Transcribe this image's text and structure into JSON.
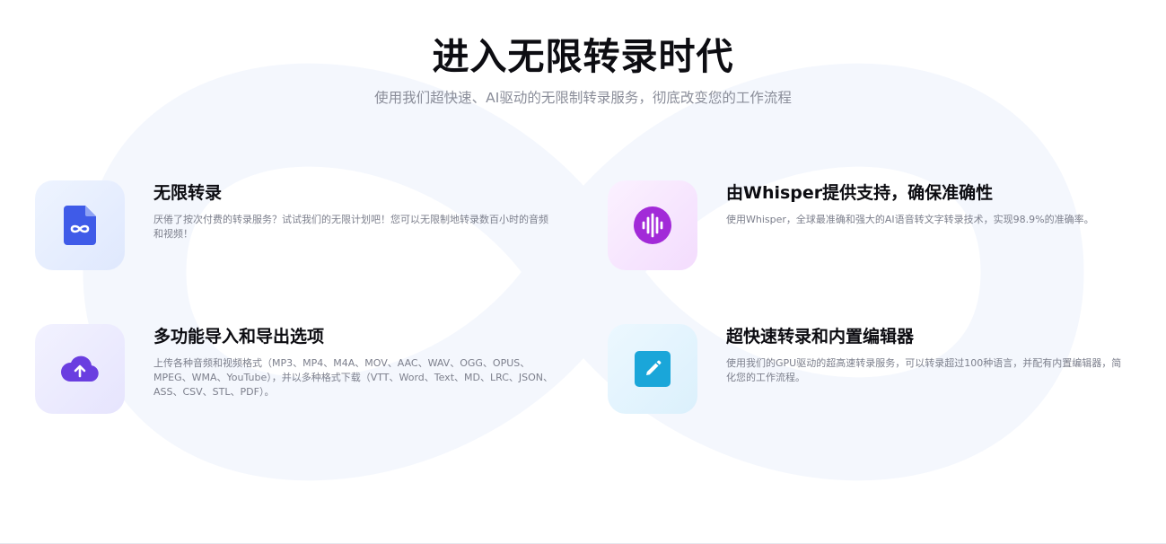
{
  "header": {
    "title": "进入无限转录时代",
    "subtitle": "使用我们超快速、AI驱动的无限制转录服务，彻底改变您的工作流程"
  },
  "features": [
    {
      "title": "无限转录",
      "description": "厌倦了按次付费的转录服务？试试我们的无限计划吧！您可以无限制地转录数百小时的音频和视频！",
      "icon": "infinity-document-icon",
      "accent": "#3f5be8"
    },
    {
      "title": "由Whisper提供支持，确保准确性",
      "description": "使用Whisper，全球最准确和强大的AI语音转文字转录技术，实现98.9%的准确率。",
      "icon": "sound-wave-icon",
      "accent": "#a22ad8"
    },
    {
      "title": "多功能导入和导出选项",
      "description": "上传各种音频和视频格式（MP3、MP4、M4A、MOV、AAC、WAV、OGG、OPUS、MPEG、WMA、YouTube），并以多种格式下载（VTT、Word、Text、MD、LRC、JSON、ASS、CSV、STL、PDF）。",
      "icon": "cloud-upload-icon",
      "accent": "#6a3ee0"
    },
    {
      "title": "超快速转录和内置编辑器",
      "description": "使用我们的GPU驱动的超高速转录服务，可以转录超过100种语言，并配有内置编辑器，简化您的工作流程。",
      "icon": "pencil-icon",
      "accent": "#1aa6d9"
    }
  ],
  "colors": {
    "background_infinity": "#f4f7fd",
    "title": "#0d0d12",
    "subtitle": "#8a8d99",
    "description": "#7c7f8c"
  }
}
